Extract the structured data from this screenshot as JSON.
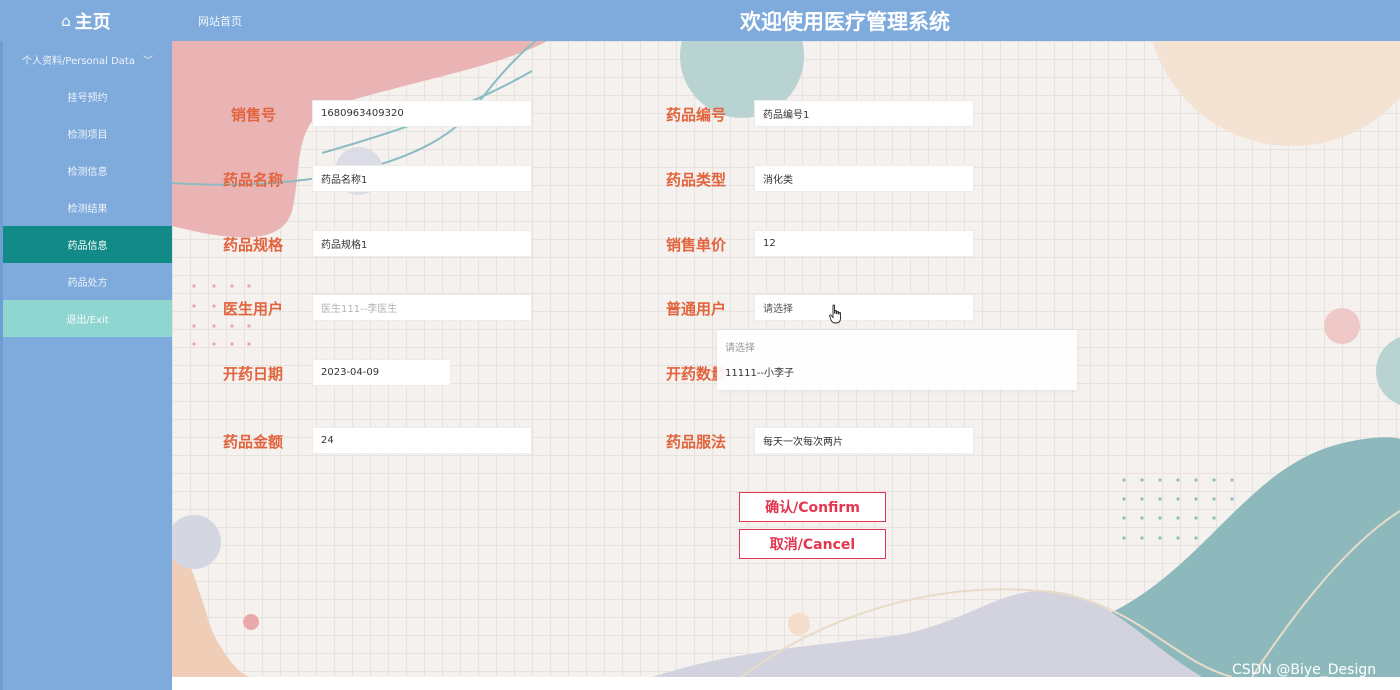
{
  "header": {
    "home_label": "主页",
    "home_icon": "home-icon",
    "site_home_link": "网站首页",
    "system_title": "欢迎使用医疗管理系统"
  },
  "sidebar": {
    "group_label": "个人资料/Personal Data",
    "items": [
      {
        "label": "挂号预约"
      },
      {
        "label": "检测项目"
      },
      {
        "label": "检测信息"
      },
      {
        "label": "检测结果"
      },
      {
        "label": "药品信息"
      },
      {
        "label": "药品处方"
      },
      {
        "label": "退出/Exit"
      }
    ],
    "active_item": "药品信息"
  },
  "form": {
    "sale_no": {
      "label": "销售号",
      "value": "1680963409320"
    },
    "drug_code": {
      "label": "药品编号",
      "value": "药品编号1"
    },
    "drug_name": {
      "label": "药品名称",
      "value": "药品名称1"
    },
    "drug_type": {
      "label": "药品类型",
      "value": "消化类"
    },
    "drug_spec": {
      "label": "药品规格",
      "value": "药品规格1"
    },
    "unit_price": {
      "label": "销售单价",
      "value": "12"
    },
    "doctor_user": {
      "label": "医生用户",
      "placeholder": "医生111--李医生"
    },
    "normal_user": {
      "label": "普通用户",
      "placeholder": "请选择"
    },
    "prescribe_date": {
      "label": "开药日期",
      "value": "2023-04-09"
    },
    "prescribe_qty": {
      "label": "开药数量"
    },
    "drug_amount": {
      "label": "药品金额",
      "value": "24"
    },
    "drug_usage": {
      "label": "药品服法",
      "value": "每天一次每次两片"
    }
  },
  "dropdown": {
    "options": [
      "请选择",
      "11111--小李子"
    ]
  },
  "buttons": {
    "confirm": "确认/Confirm",
    "cancel": "取消/Cancel"
  },
  "watermark": "CSDN @Biye_Design",
  "colors": {
    "header_bg": "#7eabdc",
    "active_item_bg": "#128a87",
    "exit_item_bg": "#8fd6d0",
    "label_color": "#e2643f",
    "button_color": "#e33650"
  }
}
